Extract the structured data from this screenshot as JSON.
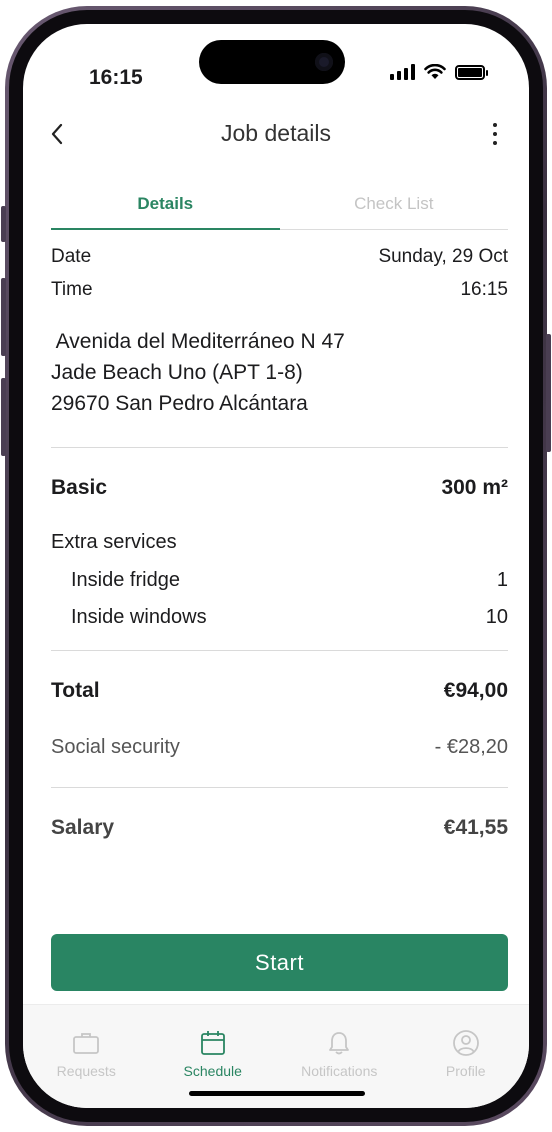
{
  "status_bar": {
    "time": "16:15"
  },
  "header": {
    "title": "Job details"
  },
  "tabs": [
    {
      "label": "Details",
      "active": true
    },
    {
      "label": "Check List",
      "active": false
    }
  ],
  "details": {
    "date_label": "Date",
    "date_value": "Sunday, 29 Oct",
    "time_label": "Time",
    "time_value": "16:15",
    "address_lines": [
      " Avenida del Mediterráneo N 47",
      "Jade Beach Uno (APT 1-8)",
      "29670 San Pedro Alcántara"
    ],
    "basic_label": "Basic",
    "basic_value": "300 m²",
    "extra_services_title": "Extra services",
    "extra_services": [
      {
        "label": "Inside fridge",
        "value": "1"
      },
      {
        "label": "Inside windows",
        "value": "10"
      }
    ],
    "total_label": "Total",
    "total_value": "€94,00",
    "social_security_label": "Social security",
    "social_security_value": "- €28,20",
    "salary_label": "Salary",
    "salary_value": "€41,55"
  },
  "start_button": {
    "label": "Start"
  },
  "tab_bar": [
    {
      "label": "Requests",
      "icon": "briefcase-icon",
      "active": false
    },
    {
      "label": "Schedule",
      "icon": "calendar-icon",
      "active": true
    },
    {
      "label": "Notifications",
      "icon": "bell-icon",
      "active": false
    },
    {
      "label": "Profile",
      "icon": "profile-icon",
      "active": false
    }
  ],
  "colors": {
    "accent": "#298563",
    "inactive": "#c6c6c6"
  }
}
